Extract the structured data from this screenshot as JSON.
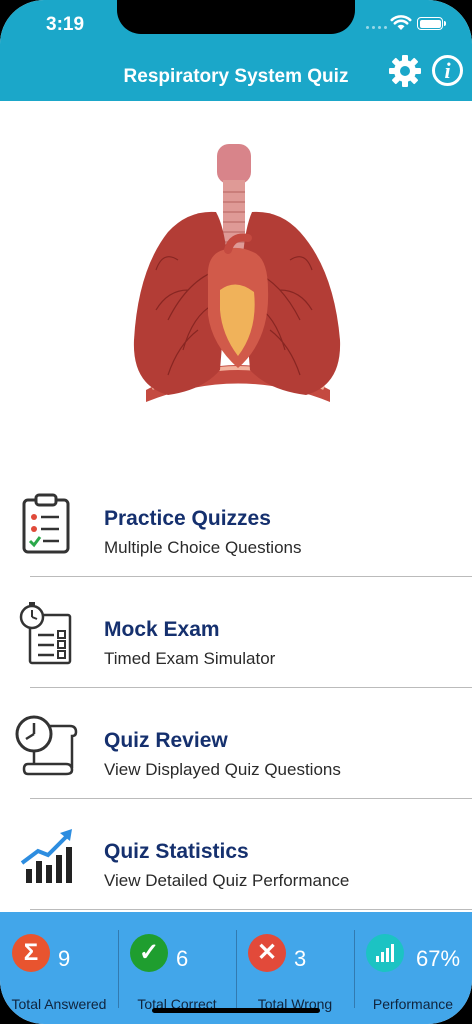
{
  "status": {
    "time": "3:19"
  },
  "header": {
    "title": "Respiratory System Quiz",
    "settings_icon": "gear-icon",
    "info_icon": "info-icon",
    "info_glyph": "i"
  },
  "menu": [
    {
      "title": "Practice Quizzes",
      "subtitle": "Multiple Choice Questions",
      "icon": "clipboard-checklist-icon"
    },
    {
      "title": "Mock Exam",
      "subtitle": "Timed Exam Simulator",
      "icon": "stopwatch-checklist-icon"
    },
    {
      "title": "Quiz Review",
      "subtitle": "View Displayed Quiz Questions",
      "icon": "clock-scroll-icon"
    },
    {
      "title": "Quiz Statistics",
      "subtitle": "View Detailed Quiz Performance",
      "icon": "bar-chart-icon"
    }
  ],
  "stats": [
    {
      "label": "Total Answered",
      "value": "9",
      "glyph": "Σ",
      "color": "#e8542f",
      "icon": "sigma-icon"
    },
    {
      "label": "Total Correct",
      "value": "6",
      "glyph": "✓",
      "color": "#1f9e2f",
      "icon": "check-icon"
    },
    {
      "label": "Total Wrong",
      "value": "3",
      "glyph": "✕",
      "color": "#e24a3a",
      "icon": "x-icon"
    },
    {
      "label": "Performance",
      "value": "67%",
      "glyph": "",
      "color": "#1cc3c3",
      "icon": "bar-chart-icon"
    }
  ],
  "colors": {
    "header": "#1ba7c9",
    "stats_bar": "#42a6ea",
    "menu_title": "#15306e"
  }
}
